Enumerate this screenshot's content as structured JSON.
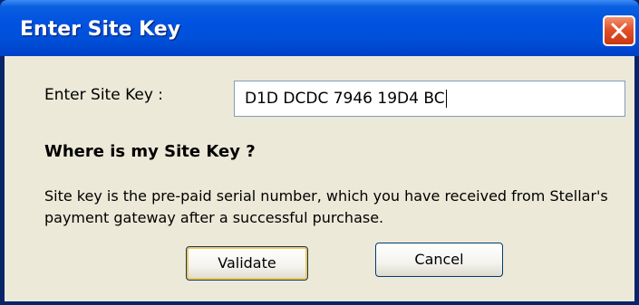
{
  "window": {
    "title": "Enter Site Key"
  },
  "form": {
    "key_label": "Enter Site Key :",
    "key_value": "D1D DCDC 7946 19D4 BC"
  },
  "help": {
    "heading": "Where is my Site Key ?",
    "description": "Site key is the pre-paid serial number, which you have received from Stellar's payment  gateway after a successful purchase."
  },
  "buttons": {
    "validate_label": "Validate",
    "cancel_label": "Cancel"
  },
  "icons": {
    "close": "close-icon"
  }
}
